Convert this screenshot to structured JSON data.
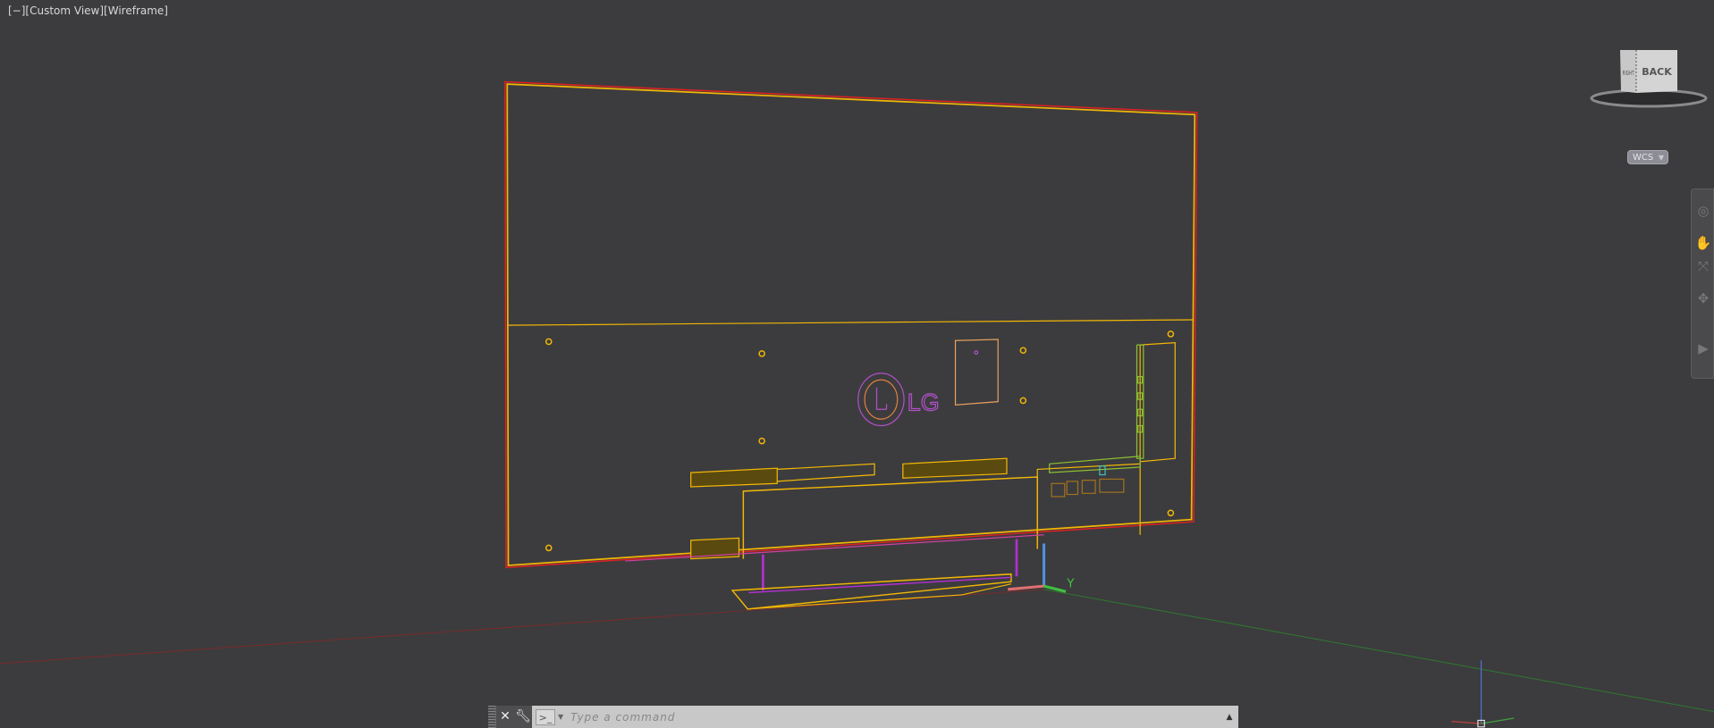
{
  "viewport": {
    "label": "[−][Custom View][Wireframe]",
    "visual_style": "Wireframe",
    "view_name": "Custom View"
  },
  "model": {
    "logo_text": "LG",
    "colors": {
      "outline": "#f2b705",
      "edge_red": "#e02020",
      "logo": "#b050c8",
      "stand_post": "#b030d0",
      "connector_green": "#8fbf30"
    }
  },
  "viewcube": {
    "face_label": "BACK",
    "side_label": "RIGHT"
  },
  "ucs": {
    "button_label": "WCS",
    "y_axis_label": "Y",
    "icon": "caret-down-icon"
  },
  "navbar": {
    "icons": [
      "steering-wheel-icon",
      "pan-icon",
      "zoom-icon",
      "orbit-icon",
      "showmotion-icon"
    ]
  },
  "command_line": {
    "placeholder": "Type a command",
    "value": "",
    "close_icon": "close-icon",
    "customize_icon": "wrench-icon",
    "prompt_icon": "prompt-icon",
    "history_icon": "caret-up-icon"
  }
}
